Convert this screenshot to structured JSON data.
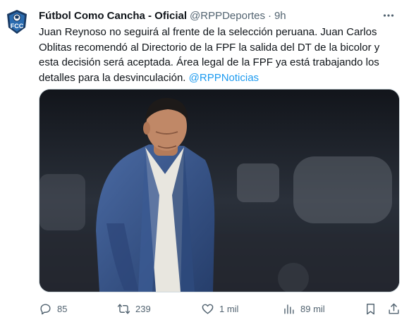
{
  "tweet": {
    "avatar": {
      "text": "FCC",
      "icon": "fcc-logo-icon",
      "colors": {
        "primary": "#2b6cb0",
        "dark": "#1a3a63"
      }
    },
    "display_name": "Fútbol Como Cancha - Oficial",
    "handle": "@RPPDeportes",
    "separator": "·",
    "time": "9h",
    "text": "Juan Reynoso no seguirá al frente de la selección peruana. Juan Carlos Oblitas recomendó al Directorio de la FPF la salida del DT de la bicolor y esta decisión será aceptada. Área legal de la FPF ya está trabajando los detalles para la desvinculación.",
    "mention": "@RPPNoticias",
    "media": {
      "description_icon": "coach-photo"
    },
    "actions": {
      "reply": {
        "icon": "reply-icon",
        "count": "85"
      },
      "retweet": {
        "icon": "retweet-icon",
        "count": "239"
      },
      "like": {
        "icon": "heart-icon",
        "count": "1 mil"
      },
      "views": {
        "icon": "views-icon",
        "count": "89 mil"
      },
      "bookmark": {
        "icon": "bookmark-icon"
      },
      "share": {
        "icon": "share-icon"
      }
    }
  },
  "colors": {
    "text": "#0f1419",
    "secondary": "#536471",
    "accent": "#1d9bf0",
    "border": "#cfd9de"
  }
}
